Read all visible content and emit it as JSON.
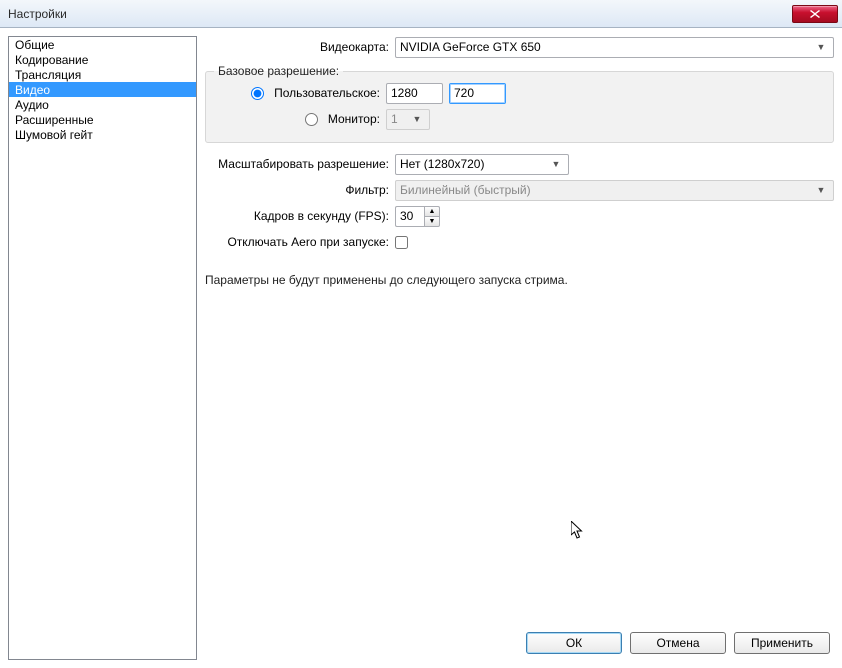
{
  "window": {
    "title": "Настройки"
  },
  "sidebar": {
    "items": [
      {
        "label": "Общие"
      },
      {
        "label": "Кодирование"
      },
      {
        "label": "Трансляция"
      },
      {
        "label": "Видео",
        "selected": true
      },
      {
        "label": "Аудио"
      },
      {
        "label": "Расширенные"
      },
      {
        "label": "Шумовой гейт"
      }
    ]
  },
  "form": {
    "video_card_label": "Видеокарта:",
    "video_card_value": "NVIDIA GeForce GTX 650",
    "base_res_legend": "Базовое разрешение:",
    "custom_radio_label": "Пользовательское:",
    "custom_width": "1280",
    "custom_height": "720",
    "monitor_radio_label": "Монитор:",
    "monitor_value": "1",
    "scale_res_label": "Масштабировать разрешение:",
    "scale_res_value": "Нет  (1280x720)",
    "filter_label": "Фильтр:",
    "filter_value": "Билинейный (быстрый)",
    "fps_label": "Кадров в секунду (FPS):",
    "fps_value": "30",
    "disable_aero_label": "Отключать Aero при запуске:",
    "note": "Параметры не будут применены до следующего запуска стрима."
  },
  "buttons": {
    "ok": "ОК",
    "cancel": "Отмена",
    "apply": "Применить"
  }
}
